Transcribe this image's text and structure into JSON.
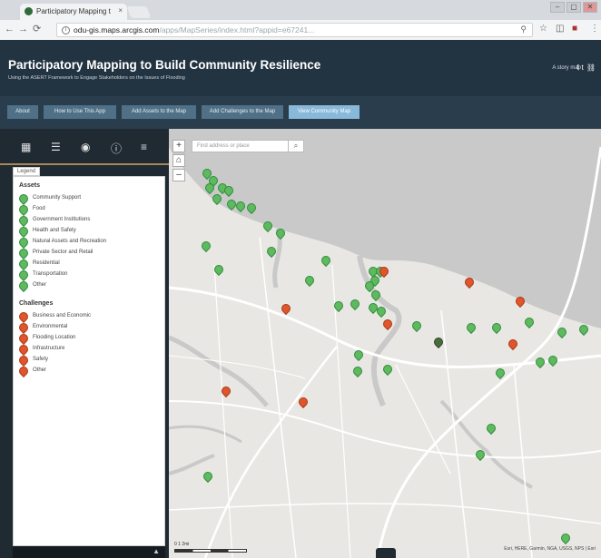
{
  "browser": {
    "tab_title": "Participatory Mapping t",
    "tab_close": "×",
    "url_host": "odu-gis.maps.arcgis.com",
    "url_path": "/apps/MapSeries/index.html?appid=e67241..."
  },
  "app": {
    "title": "Participatory Mapping to Build Community Resilience",
    "subtitle": "Using the ASERT Framework to Engage Stakeholders on the Issues of Flooding",
    "story_map": "A story map"
  },
  "tabs": [
    {
      "label": "About"
    },
    {
      "label": "How to Use This App"
    },
    {
      "label": "Add Assets to the Map"
    },
    {
      "label": "Add Challenges to the Map"
    },
    {
      "label": "View Community Map"
    }
  ],
  "panel": {
    "legend_tab": "Legend",
    "assets_heading": "Assets",
    "assets": [
      {
        "label": "Community Support"
      },
      {
        "label": "Food"
      },
      {
        "label": "Government Institutions"
      },
      {
        "label": "Health and Safety"
      },
      {
        "label": "Natural Assets and Recreation"
      },
      {
        "label": "Private Sector and Retail"
      },
      {
        "label": "Residential"
      },
      {
        "label": "Transportation"
      },
      {
        "label": "Other"
      }
    ],
    "challenges_heading": "Challenges",
    "challenges": [
      {
        "label": "Business and Economic"
      },
      {
        "label": "Environmental"
      },
      {
        "label": "Flooding Location"
      },
      {
        "label": "Infrastructure"
      },
      {
        "label": "Safety"
      },
      {
        "label": "Other"
      }
    ]
  },
  "map": {
    "search_placeholder": "Find address or place",
    "scale_label": "0     1     2mi",
    "attribution": "Esri, HERE, Garmin, NGA, USGS, NPS | Esri"
  },
  "colors": {
    "asset_pin": "#5fb95f",
    "challenge_pin": "#e0552b",
    "header_bg": "#223341",
    "active_tab": "#88b9d9"
  }
}
